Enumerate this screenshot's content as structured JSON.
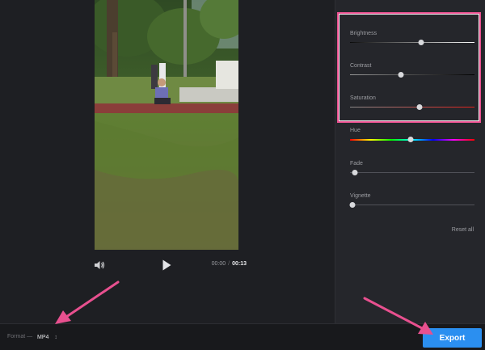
{
  "player": {
    "current_time": "00:00",
    "separator": "/",
    "duration": "00:13",
    "icons": {
      "volume": "volume-icon",
      "play": "play-icon"
    }
  },
  "adjustments": [
    {
      "label": "Brightness",
      "value": 0.57
    },
    {
      "label": "Contrast",
      "value": 0.41
    },
    {
      "label": "Saturation",
      "value": 0.56
    },
    {
      "label": "Hue",
      "value": 0.49
    },
    {
      "label": "Fade",
      "value": 0.04
    },
    {
      "label": "Vignette",
      "value": 0.02
    }
  ],
  "reset_label": "Reset all",
  "format": {
    "label": "Format —",
    "value": "MP4"
  },
  "export_label": "Export",
  "colors": {
    "accent": "#2b8ff0",
    "annotation": "#e8508f",
    "panel": "#25262b",
    "background": "#1e1f23"
  }
}
